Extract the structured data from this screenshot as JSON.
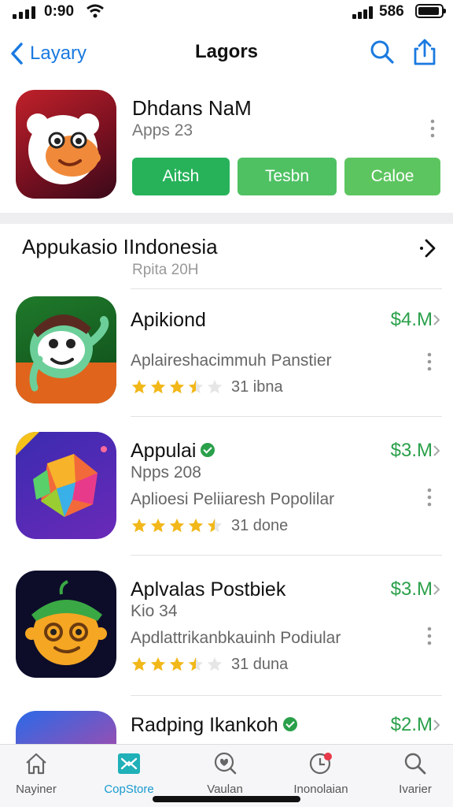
{
  "status_bar": {
    "time": "0:90",
    "battery_text": "586"
  },
  "nav": {
    "back_label": "Layary",
    "title": "Lagors"
  },
  "featured": {
    "name": "Dhdans NaM",
    "subtitle": "Apps 23",
    "buttons": [
      "Aitsh",
      "Tesbn",
      "Caloe"
    ]
  },
  "section": {
    "title": "Appukasio  IIndonesia",
    "subtitle": "Rpita 20H",
    "apps": [
      {
        "name": "Apikiond",
        "line2": "",
        "line3": "Aplaireshacimmuh Panstier",
        "price": "$4.M",
        "rating": 3.5,
        "count": "31 ibna",
        "verified": false
      },
      {
        "name": "Appulai",
        "line2": "Npps 208",
        "line3": "Aplioesi Peliiaresh Popolilar",
        "price": "$3.M",
        "rating": 4.5,
        "count": "31 done",
        "verified": true
      },
      {
        "name": "Aplvalas Postbiek",
        "line2": "Kio 34",
        "line3": "Apdlattrikanbkauinh Podiular",
        "price": "$3.M",
        "rating": 3.5,
        "count": "31 duna",
        "verified": false
      },
      {
        "name": "Radping Ikankoh",
        "line2": "",
        "line3": "",
        "price": "$2.M",
        "rating": 0,
        "count": "",
        "verified": true
      }
    ]
  },
  "tabbar": {
    "tabs": [
      {
        "label": "Nayiner",
        "icon": "home-icon"
      },
      {
        "label": "CopStore",
        "icon": "appstore-icon"
      },
      {
        "label": "Vaulan",
        "icon": "search-heart-icon"
      },
      {
        "label": "Inonolaian",
        "icon": "updates-icon"
      },
      {
        "label": "Ivarier",
        "icon": "search-icon"
      }
    ],
    "active_index": 1
  },
  "colors": {
    "accent": "#1a7ae0",
    "price_green": "#2aa04a",
    "star": "#f2b81a"
  }
}
